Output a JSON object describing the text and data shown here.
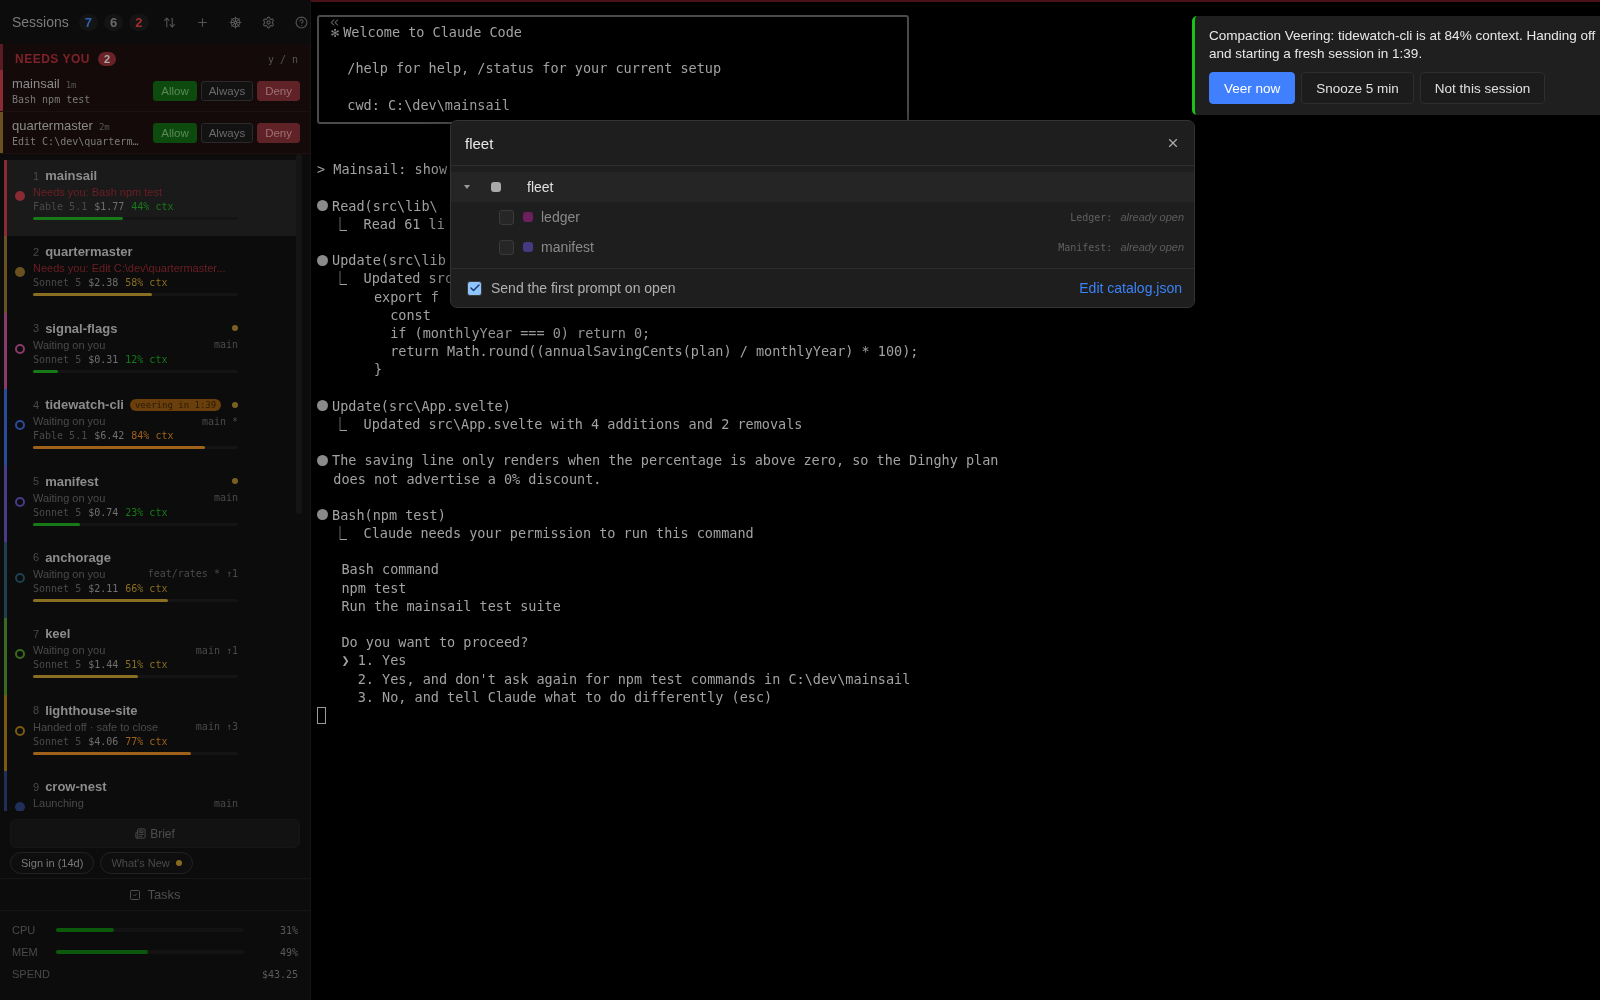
{
  "sidebar": {
    "title": "Sessions",
    "counts": [
      {
        "text": "7",
        "color": "#2f5fb0"
      },
      {
        "text": "6",
        "color": "#6a6a6a"
      },
      {
        "text": "2",
        "color": "#a0302f"
      }
    ],
    "needs_you": {
      "title": "NEEDS YOU",
      "count": "2",
      "hint": "y / n",
      "items": [
        {
          "name": "mainsail",
          "age": "1m",
          "detail": "Bash npm test",
          "color": "#8a2a33",
          "actions": [
            {
              "label": "Allow",
              "kind": "allow"
            },
            {
              "label": "Always",
              "kind": "always"
            },
            {
              "label": "Deny",
              "kind": "deny"
            }
          ]
        },
        {
          "name": "quartermaster",
          "age": "2m",
          "detail": "Edit C:\\dev\\quarterm…",
          "color": "#6a5220",
          "actions": [
            {
              "label": "Allow",
              "kind": "allow"
            },
            {
              "label": "Always",
              "kind": "always"
            },
            {
              "label": "Deny",
              "kind": "deny"
            }
          ]
        }
      ]
    },
    "sessions": [
      {
        "number": "1",
        "name": "mainsail",
        "status": "Needs you: Bash npm test",
        "alert": true,
        "filled": true,
        "color": "#8a2a33",
        "selected": true,
        "unread": false,
        "model": "Fable 5.1",
        "cost": "$1.77",
        "ctx": "44% ctx",
        "level": 0.44
      },
      {
        "number": "2",
        "name": "quartermaster",
        "status": "Needs you: Edit C:\\dev\\quartermaster...",
        "alert": true,
        "filled": true,
        "color": "#6a5220",
        "selected": false,
        "unread": false,
        "model": "Sonnet 5",
        "cost": "$2.38",
        "ctx": "58% ctx",
        "level": 0.58
      },
      {
        "number": "3",
        "name": "signal-flags",
        "status": "Waiting on you",
        "alert": false,
        "filled": false,
        "color": "#8a3a6a",
        "selected": false,
        "unread": true,
        "branch": "main",
        "model": "Sonnet 5",
        "cost": "$0.31",
        "ctx": "12% ctx",
        "level": 0.12
      },
      {
        "number": "4",
        "name": "tidewatch-cli",
        "badge": "veering in 1:39",
        "status": "Waiting on you",
        "alert": false,
        "filled": false,
        "color": "#2a4a9a",
        "selected": false,
        "unread": true,
        "branch": "main *",
        "model": "Fable 5.1",
        "cost": "$6.42",
        "ctx": "84% ctx",
        "level": 0.84
      },
      {
        "number": "5",
        "name": "manifest",
        "status": "Waiting on you",
        "alert": false,
        "filled": false,
        "color": "#4a3a8a",
        "selected": false,
        "unread": true,
        "branch": "main",
        "model": "Sonnet 5",
        "cost": "$0.74",
        "ctx": "23% ctx",
        "level": 0.23
      },
      {
        "number": "6",
        "name": "anchorage",
        "status": "Waiting on you",
        "alert": false,
        "filled": false,
        "color": "#1f4050",
        "selected": false,
        "unread": false,
        "branch": "feat/rates * ↑1",
        "model": "Sonnet 5",
        "cost": "$2.11",
        "ctx": "66% ctx",
        "level": 0.66
      },
      {
        "number": "7",
        "name": "keel",
        "status": "Waiting on you",
        "alert": false,
        "filled": false,
        "color": "#3a6a1f",
        "selected": false,
        "unread": false,
        "branch": "main ↑1",
        "model": "Sonnet 5",
        "cost": "$1.44",
        "ctx": "51% ctx",
        "level": 0.51
      },
      {
        "number": "8",
        "name": "lighthouse-site",
        "status": "Handed off · safe to close",
        "alert": false,
        "filled": false,
        "color": "#7a5a10",
        "selected": false,
        "unread": false,
        "branch": "main ↑3",
        "model": "Sonnet 5",
        "cost": "$4.06",
        "ctx": "77% ctx",
        "level": 0.77
      },
      {
        "number": "9",
        "name": "crow-nest",
        "status": "Launching",
        "alert": false,
        "filled": true,
        "color": "#1f2f5a",
        "selected": false,
        "unread": false,
        "branch": "main"
      }
    ],
    "brief": "Brief",
    "pills": [
      {
        "label": "Sign in (14d)",
        "dot": false
      },
      {
        "label": "What's New",
        "dot": true
      }
    ],
    "tasks": "Tasks",
    "stats": [
      {
        "label": "CPU",
        "value": "31%",
        "level": 0.31
      },
      {
        "label": "MEM",
        "value": "49%",
        "level": 0.49
      },
      {
        "label": "SPEND",
        "value": "$43.25"
      }
    ]
  },
  "terminal": {
    "welcome": {
      "mark": "✻",
      "title": "Welcome to Claude Code",
      "lines": [
        {
          "kind": "blank"
        },
        {
          "kind": "text",
          "text": "  /help for help, /status for your current setup"
        },
        {
          "kind": "blank"
        },
        {
          "kind": "text",
          "text": "  cwd: C:\\dev\\mainsail"
        }
      ]
    },
    "lines": [
      {
        "kind": "blank"
      },
      {
        "kind": "blank"
      },
      {
        "kind": "text",
        "text": "> Mainsail: show"
      },
      {
        "kind": "blank"
      },
      {
        "kind": "bullet",
        "text": "Read(src\\lib\\"
      },
      {
        "kind": "text",
        "text": "  ⎿  Read 61 li"
      },
      {
        "kind": "blank"
      },
      {
        "kind": "bullet",
        "text": "Update(src\\lib"
      },
      {
        "kind": "text",
        "text": "  ⎿  Updated src"
      },
      {
        "kind": "text",
        "text": "       export f"
      },
      {
        "kind": "text",
        "text": "         const"
      },
      {
        "kind": "text",
        "text": "         if (monthlyYear === 0) return 0;"
      },
      {
        "kind": "text",
        "text": "         return Math.round((annualSavingCents(plan) / monthlyYear) * 100);"
      },
      {
        "kind": "text",
        "text": "       }"
      },
      {
        "kind": "blank"
      },
      {
        "kind": "bullet",
        "text": "Update(src\\App.svelte)"
      },
      {
        "kind": "text",
        "text": "  ⎿  Updated src\\App.svelte with 4 additions and 2 removals"
      },
      {
        "kind": "blank"
      },
      {
        "kind": "bullet",
        "text": "The saving line only renders when the percentage is above zero, so the Dinghy plan"
      },
      {
        "kind": "text",
        "text": "  does not advertise a 0% discount."
      },
      {
        "kind": "blank"
      },
      {
        "kind": "bullet",
        "text": "Bash(npm test)"
      },
      {
        "kind": "text",
        "text": "  ⎿  Claude needs your permission to run this command"
      },
      {
        "kind": "blank"
      },
      {
        "kind": "text",
        "text": "   Bash command"
      },
      {
        "kind": "text",
        "text": "   npm test"
      },
      {
        "kind": "text",
        "text": "   Run the mainsail test suite"
      },
      {
        "kind": "blank"
      },
      {
        "kind": "text",
        "text": "   Do you want to proceed?"
      },
      {
        "kind": "text",
        "text": "   ❯ 1. Yes"
      },
      {
        "kind": "text",
        "text": "     2. Yes, and don't ask again for npm test commands in C:\\dev\\mainsail"
      },
      {
        "kind": "text",
        "text": "     3. No, and tell Claude what to do differently (esc)"
      },
      {
        "kind": "cursor"
      }
    ]
  },
  "picker": {
    "query": "fleet",
    "groups": [
      {
        "label": "fleet",
        "expanded": true,
        "children": [
          {
            "label": "ledger",
            "checked": false,
            "color": "#6b1f5c",
            "note_label": "Ledger:",
            "note": "already open"
          },
          {
            "label": "manifest",
            "checked": false,
            "color": "#453a80",
            "note_label": "Manifest:",
            "note": "already open"
          }
        ]
      }
    ],
    "send_first_prompt": {
      "label": "Send the first prompt on open",
      "checked": true
    },
    "link": "Edit catalog.json"
  },
  "toast": {
    "message": "Compaction Veering: tidewatch-cli is at 84% context. Handing off and starting a fresh session in 1:39.",
    "buttons": [
      {
        "label": "Veer now",
        "kind": "primary"
      },
      {
        "label": "Snooze 5 min",
        "kind": "secondary"
      },
      {
        "label": "Not this session",
        "kind": "secondary"
      }
    ]
  }
}
